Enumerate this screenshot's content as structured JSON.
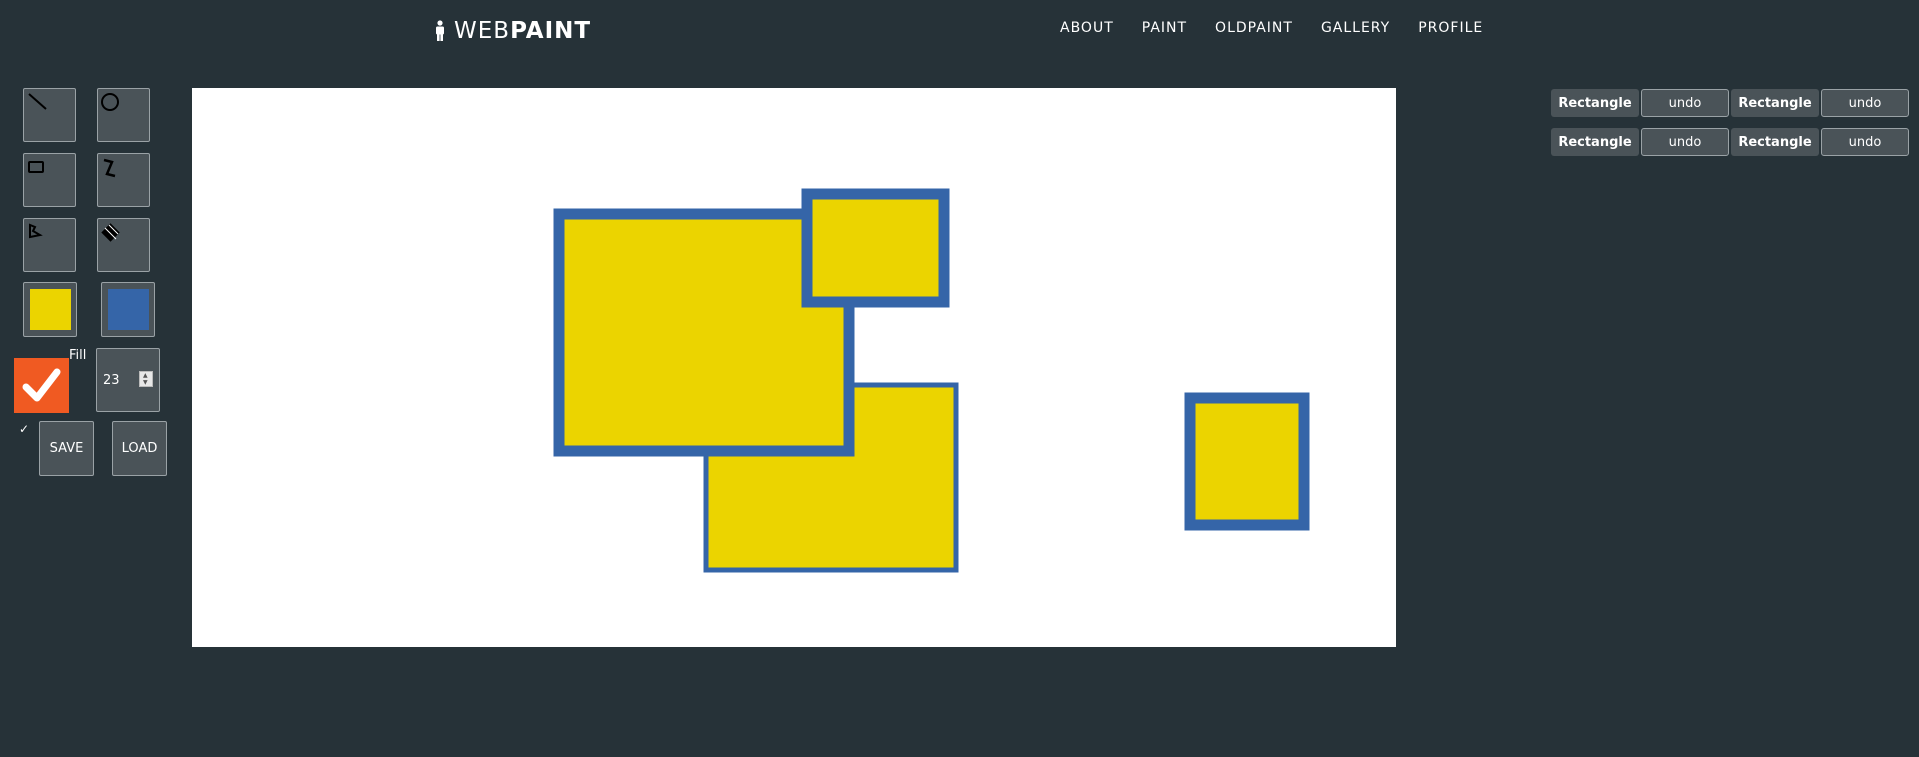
{
  "brand": {
    "prefix": "WEB",
    "bold": "PAINT",
    "icon": "person-icon"
  },
  "nav": [
    "ABOUT",
    "PAINT",
    "OLDPAINT",
    "GALLERY",
    "PROFILE"
  ],
  "tools": [
    {
      "name": "line",
      "icon": "line-icon"
    },
    {
      "name": "circle",
      "icon": "circle-icon"
    },
    {
      "name": "rectangle",
      "icon": "rectangle-icon"
    },
    {
      "name": "polyline",
      "icon": "polyline-icon"
    },
    {
      "name": "polygon",
      "icon": "polygon-icon"
    },
    {
      "name": "eraser",
      "icon": "eraser-icon"
    }
  ],
  "colors": {
    "fill": "#ebd400",
    "stroke": "#3565a8",
    "accent": "#f05a22",
    "background": "#263238"
  },
  "fill": {
    "label": "Fill",
    "checked": true,
    "tick": "✓"
  },
  "brush_size": "23",
  "buttons": {
    "save": "SAVE",
    "load": "LOAD"
  },
  "shapes_count": 4,
  "history": [
    {
      "label": "Rectangle",
      "action": "undo"
    },
    {
      "label": "Rectangle",
      "action": "undo"
    },
    {
      "label": "Rectangle",
      "action": "undo"
    },
    {
      "label": "Rectangle",
      "action": "undo"
    }
  ]
}
